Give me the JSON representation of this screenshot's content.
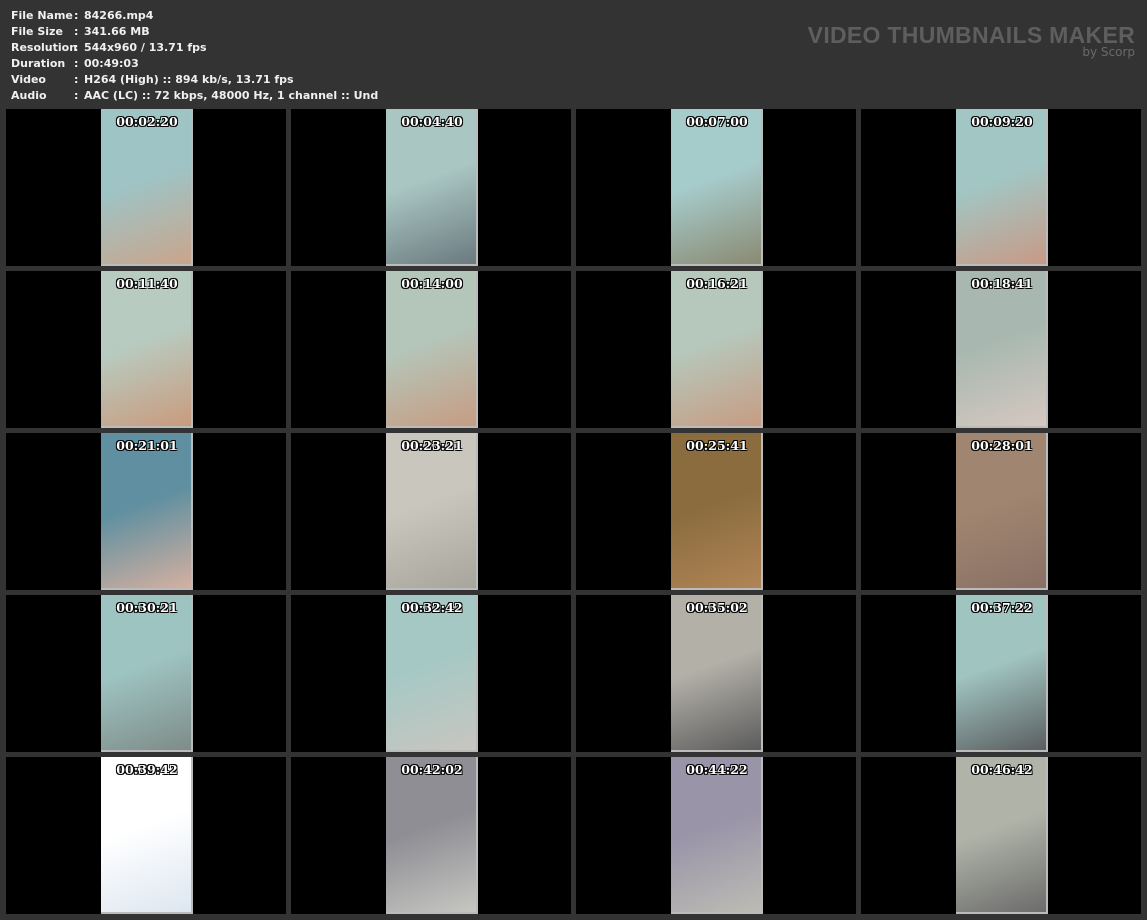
{
  "info": [
    {
      "key": "File Name",
      "value": "84266.mp4"
    },
    {
      "key": "File Size",
      "value": "341.66 MB"
    },
    {
      "key": "Resolution",
      "value": "544x960 / 13.71 fps"
    },
    {
      "key": "Duration",
      "value": "00:49:03"
    },
    {
      "key": "Video",
      "value": "H264 (High) :: 894 kb/s, 13.71 fps"
    },
    {
      "key": "Audio",
      "value": "AAC (LC) :: 72 kbps, 48000 Hz, 1 channel :: Und"
    }
  ],
  "separator": ":",
  "brand": {
    "title": "VIDEO THUMBNAILS MAKER",
    "byline": "by Scorp"
  },
  "thumbnails": [
    {
      "time": "00:02:20",
      "c1": "#9ec4c6",
      "c2": "#c9a58c"
    },
    {
      "time": "00:04:40",
      "c1": "#a9c6c2",
      "c2": "#6b7a80"
    },
    {
      "time": "00:07:00",
      "c1": "#a6cbcb",
      "c2": "#8a8a72"
    },
    {
      "time": "00:09:20",
      "c1": "#a2c6c4",
      "c2": "#c89a86"
    },
    {
      "time": "00:11:40",
      "c1": "#b8cbc0",
      "c2": "#c99b7e"
    },
    {
      "time": "00:14:00",
      "c1": "#b4c6ba",
      "c2": "#c79c82"
    },
    {
      "time": "00:16:21",
      "c1": "#b6c8bc",
      "c2": "#c79c82"
    },
    {
      "time": "00:18:41",
      "c1": "#a8b8b0",
      "c2": "#d6c8c0"
    },
    {
      "time": "00:21:01",
      "c1": "#5f8fa0",
      "c2": "#d4b0a0"
    },
    {
      "time": "00:23:21",
      "c1": "#c9c6bd",
      "c2": "#a8a69c"
    },
    {
      "time": "00:25:41",
      "c1": "#8a6c3e",
      "c2": "#b08456"
    },
    {
      "time": "00:28:01",
      "c1": "#a08670",
      "c2": "#8a7064"
    },
    {
      "time": "00:30:21",
      "c1": "#9ec4c2",
      "c2": "#7e8c88"
    },
    {
      "time": "00:32:42",
      "c1": "#a6c8c4",
      "c2": "#c8c6c0"
    },
    {
      "time": "00:35:02",
      "c1": "#b3b0a8",
      "c2": "#5c5c5c"
    },
    {
      "time": "00:37:22",
      "c1": "#a0c4c0",
      "c2": "#5a5e60"
    },
    {
      "time": "00:39:42",
      "c1": "#ffffff",
      "c2": "#dde6f0"
    },
    {
      "time": "00:42:02",
      "c1": "#8e8e94",
      "c2": "#c6c6c2"
    },
    {
      "time": "00:44:22",
      "c1": "#9a94a8",
      "c2": "#bcbcb4"
    },
    {
      "time": "00:46:42",
      "c1": "#b0b4a8",
      "c2": "#6c6c6c"
    }
  ]
}
